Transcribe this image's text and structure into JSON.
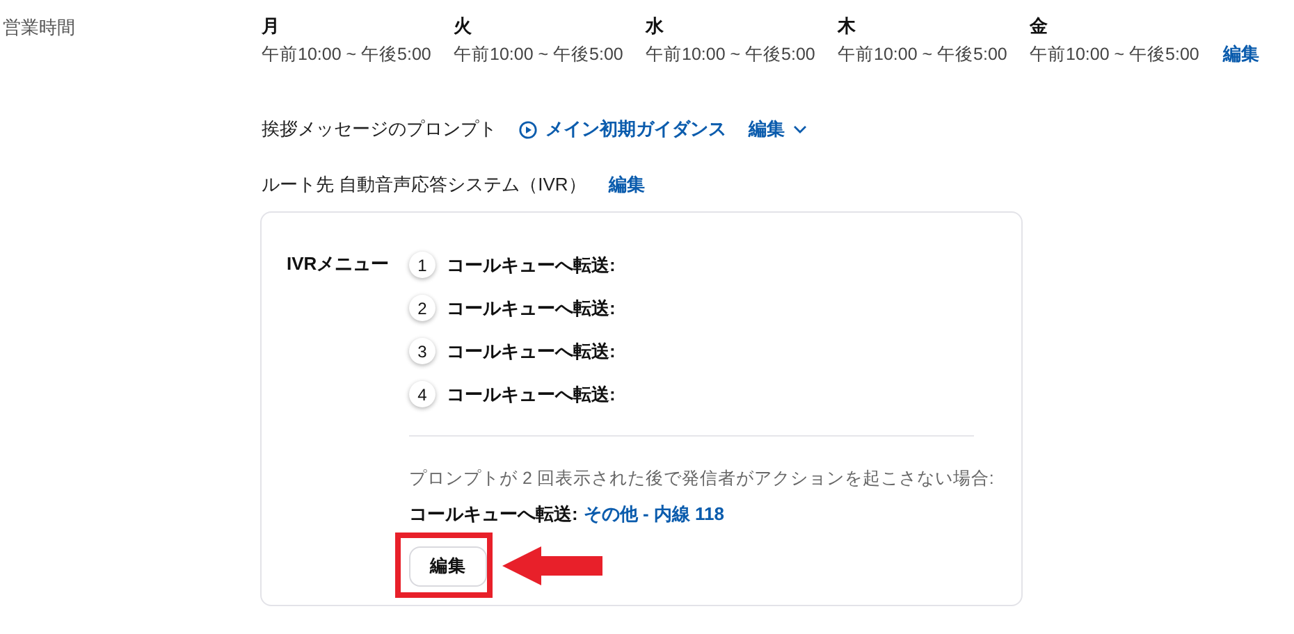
{
  "business_hours": {
    "label": "営業時間",
    "days": [
      {
        "day": "月",
        "hours": "午前10:00 ~ 午後5:00"
      },
      {
        "day": "火",
        "hours": "午前10:00 ~ 午後5:00"
      },
      {
        "day": "水",
        "hours": "午前10:00 ~ 午後5:00"
      },
      {
        "day": "木",
        "hours": "午前10:00 ~ 午後5:00"
      },
      {
        "day": "金",
        "hours": "午前10:00 ~ 午後5:00"
      }
    ],
    "edit": "編集"
  },
  "greeting": {
    "label": "挨拶メッセージのプロンプト",
    "prompt": "メイン初期ガイダンス",
    "edit": "編集"
  },
  "route": {
    "label": "ルート先 自動音声応答システム（IVR）",
    "edit": "編集"
  },
  "ivr_menu": {
    "label": "IVRメニュー",
    "items": [
      {
        "key": "1",
        "action": "コールキューへ転送:"
      },
      {
        "key": "2",
        "action": "コールキューへ転送:"
      },
      {
        "key": "3",
        "action": "コールキューへ転送:"
      },
      {
        "key": "4",
        "action": "コールキューへ転送:"
      }
    ],
    "no_action_note": "プロンプトが 2 回表示された後で発信者がアクションを起こさない場合:",
    "fallback_label": "コールキューへ転送:",
    "fallback_target": "その他 - 内線 118",
    "edit_button": "編集"
  }
}
